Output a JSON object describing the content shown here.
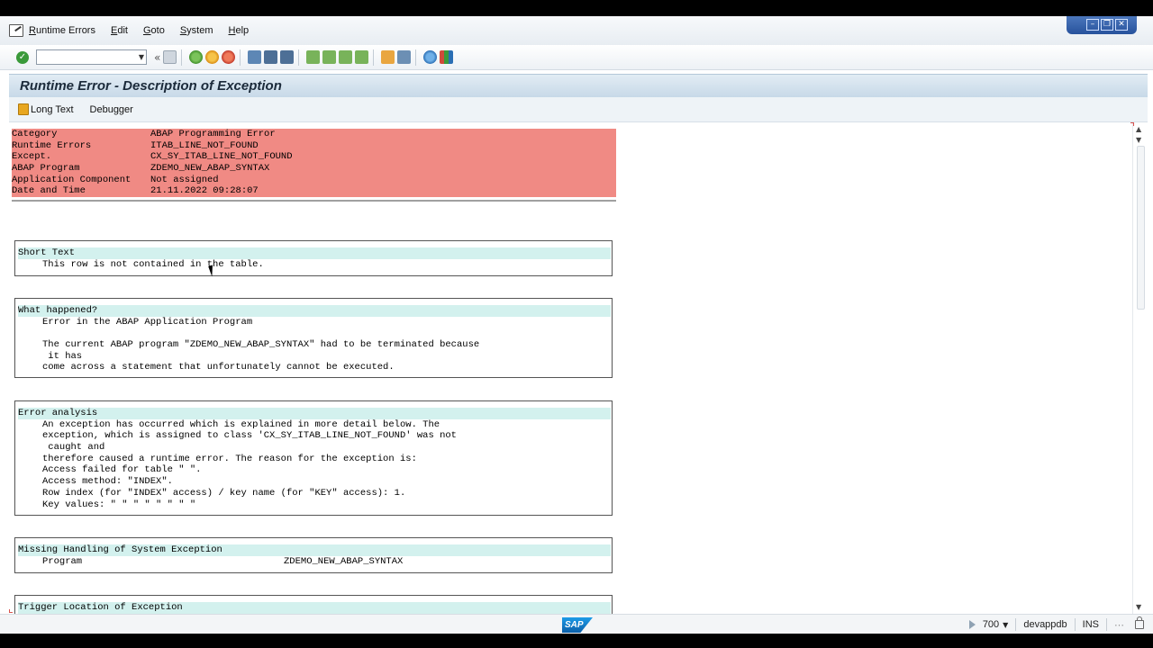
{
  "menu": {
    "items": [
      "Runtime Errors",
      "Edit",
      "Goto",
      "System",
      "Help"
    ]
  },
  "window_controls": [
    "minimize-icon",
    "restore-icon",
    "close-icon"
  ],
  "toolbar": {
    "command_field": {
      "value": "",
      "placeholder": ""
    },
    "icons": [
      "save-icon",
      "back-icon",
      "exit-icon",
      "cancel-icon",
      "print-icon",
      "find-icon",
      "find-next-icon",
      "first-page-icon",
      "previous-page-icon",
      "next-page-icon",
      "last-page-icon",
      "create-session-icon",
      "shortcut-icon",
      "help-icon",
      "layout-icon"
    ]
  },
  "title": "Runtime Error - Description of Exception",
  "app_toolbar": {
    "long_text": "Long Text",
    "debugger": "Debugger"
  },
  "header": [
    {
      "key": "Category",
      "value": "ABAP Programming Error"
    },
    {
      "key": "Runtime Errors",
      "value": "ITAB_LINE_NOT_FOUND"
    },
    {
      "key": "Except.",
      "value": "CX_SY_ITAB_LINE_NOT_FOUND"
    },
    {
      "key": "ABAP Program",
      "value": "ZDEMO_NEW_ABAP_SYNTAX"
    },
    {
      "key": "Application Component",
      "value": "Not assigned"
    },
    {
      "key": "Date and Time",
      "value": "21.11.2022 09:28:07"
    }
  ],
  "sections": {
    "short_text": {
      "title": "Short Text",
      "lines": [
        "This row is not contained in the table."
      ]
    },
    "what_happened": {
      "title": "What happened?",
      "lines": [
        "Error in the ABAP Application Program",
        "",
        "The current ABAP program \"ZDEMO_NEW_ABAP_SYNTAX\" had to be terminated because",
        " it has",
        "come across a statement that unfortunately cannot be executed."
      ]
    },
    "error_analysis": {
      "title": "Error analysis",
      "lines": [
        "An exception has occurred which is explained in more detail below. The",
        "exception, which is assigned to class 'CX_SY_ITAB_LINE_NOT_FOUND' was not",
        " caught and",
        "therefore caused a runtime error. The reason for the exception is:",
        "Access failed for table \" \".",
        "Access method: \"INDEX\".",
        "Row index (for \"INDEX\" access) / key name (for \"KEY\" access): 1.",
        "Key values: \" \" \" \" \" \" \" \""
      ]
    },
    "missing_handling": {
      "title": "Missing Handling of System Exception",
      "program_label": "Program",
      "program_value": "ZDEMO_NEW_ABAP_SYNTAX"
    },
    "trigger_location": {
      "title": "Trigger Location of Exception"
    }
  },
  "status": {
    "client": "700",
    "system": "devappdb",
    "mode": "INS",
    "logo_text": "SAP"
  }
}
